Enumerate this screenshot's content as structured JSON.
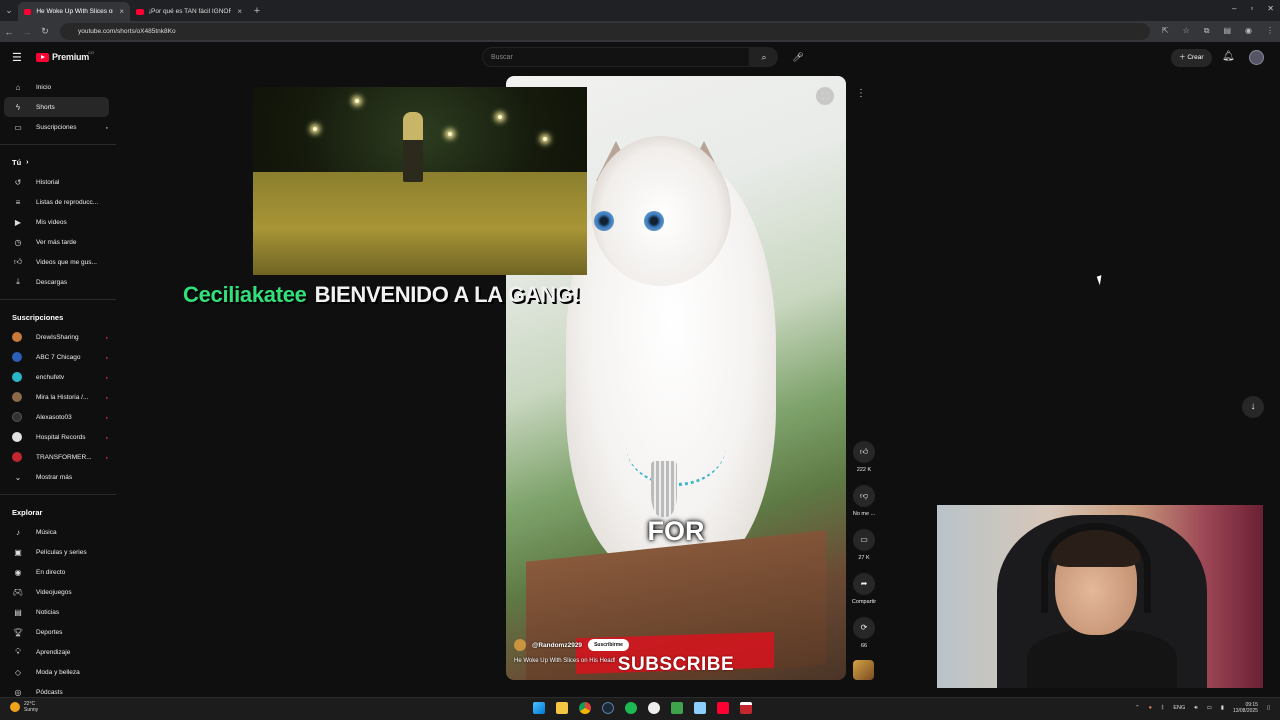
{
  "browser": {
    "tabs": [
      {
        "title": "He Woke Up With Slices on His",
        "active": true
      },
      {
        "title": "¡Por qué es TAN fácil IGNORAR",
        "active": false
      }
    ],
    "url": "youtube.com/shorts/oX485tnk8Ko"
  },
  "header": {
    "logo": "Premium",
    "logo_sup": "CO",
    "search_placeholder": "Buscar",
    "create_label": "Crear"
  },
  "sidebar": {
    "main": [
      {
        "label": "Inicio",
        "icon": "home-icon"
      },
      {
        "label": "Shorts",
        "icon": "shorts-icon"
      },
      {
        "label": "Suscripciones",
        "icon": "subscriptions-icon"
      }
    ],
    "you_header": "Tú",
    "you": [
      {
        "label": "Historial",
        "icon": "history-icon"
      },
      {
        "label": "Listas de reproducc...",
        "icon": "playlist-icon"
      },
      {
        "label": "Mis videos",
        "icon": "my-videos-icon"
      },
      {
        "label": "Ver más tarde",
        "icon": "watch-later-icon"
      },
      {
        "label": "Videos que me gus...",
        "icon": "liked-icon"
      },
      {
        "label": "Descargas",
        "icon": "download-icon"
      }
    ],
    "subs_header": "Suscripciones",
    "subs": [
      {
        "label": "DrewIsSharing",
        "color": "#c97a3a"
      },
      {
        "label": "ABC 7 Chicago",
        "color": "#2b5fb8"
      },
      {
        "label": "enchufetv",
        "color": "#29b6c9"
      },
      {
        "label": "Mira la Historia /...",
        "color": "#8a6a4a"
      },
      {
        "label": "Alexasoto03",
        "color": "#333333"
      },
      {
        "label": "Hospital Records",
        "color": "#e2e2e2"
      },
      {
        "label": "TRANSFORMER...",
        "color": "#c2272d"
      }
    ],
    "show_more": "Mostrar más",
    "explore_header": "Explorar",
    "explore": [
      {
        "label": "Música",
        "icon": "music-icon"
      },
      {
        "label": "Películas y series",
        "icon": "movies-icon"
      },
      {
        "label": "En directo",
        "icon": "live-icon"
      },
      {
        "label": "Videojuegos",
        "icon": "gaming-icon"
      },
      {
        "label": "Noticias",
        "icon": "news-icon"
      },
      {
        "label": "Deportes",
        "icon": "sports-icon"
      },
      {
        "label": "Aprendizaje",
        "icon": "learning-icon"
      },
      {
        "label": "Moda y belleza",
        "icon": "fashion-icon"
      },
      {
        "label": "Pódcasts",
        "icon": "podcast-icon"
      }
    ]
  },
  "short": {
    "caption": "FOR",
    "channel": "@Randomz2929",
    "subscribe_btn": "Suscribirme",
    "title": "He Woke Up With Slices on His Head!",
    "subscribe_banner": "SUBSCRIBE",
    "actions": {
      "likes": "222 K",
      "dislike": "No me ...",
      "comments": "27 K",
      "share": "Compartir",
      "remix": "66"
    }
  },
  "stream_alert": {
    "user": "Ceciliakatee",
    "message": "BIENVENIDO A LA GANG!"
  },
  "taskbar": {
    "temp": "22°C",
    "weather": "Sunny",
    "lang": "ENG",
    "time": "09:15",
    "date": "13/08/2025"
  }
}
